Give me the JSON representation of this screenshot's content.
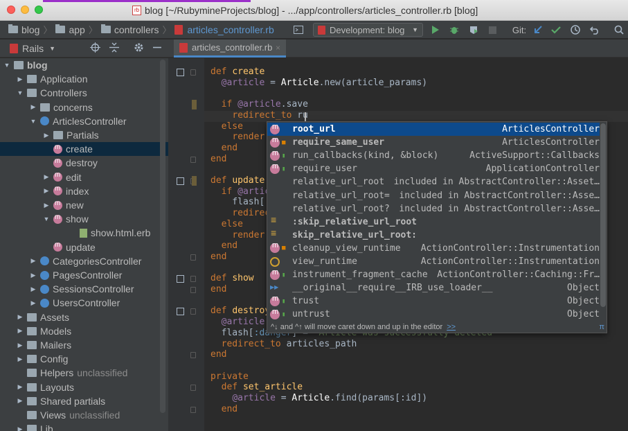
{
  "window": {
    "title": "blog [~/RubymineProjects/blog] - .../app/controllers/articles_controller.rb [blog]",
    "file_badge": "rb"
  },
  "breadcrumb": [
    "blog",
    "app",
    "controllers",
    "articles_controller.rb"
  ],
  "toolbar": {
    "run_config": "Development: blog",
    "git_label": "Git:"
  },
  "project_panel": {
    "title": "Rails"
  },
  "editor_tab": {
    "label": "articles_controller.rb",
    "close": "×"
  },
  "tree": [
    {
      "label": "blog",
      "indent": 0,
      "toggle": "▼",
      "icon": "folder",
      "bold": true
    },
    {
      "label": "Application",
      "indent": 1,
      "toggle": "▶",
      "icon": "folder"
    },
    {
      "label": "Controllers",
      "indent": 1,
      "toggle": "▼",
      "icon": "folder"
    },
    {
      "label": "concerns",
      "indent": 2,
      "toggle": "▶",
      "icon": "folder"
    },
    {
      "label": "ArticlesController",
      "indent": 2,
      "toggle": "▼",
      "icon": "ctrl"
    },
    {
      "label": "Partials",
      "indent": 3,
      "toggle": "▶",
      "icon": "folder"
    },
    {
      "label": "create",
      "indent": 3,
      "toggle": "",
      "icon": "m",
      "selected": true
    },
    {
      "label": "destroy",
      "indent": 3,
      "toggle": "",
      "icon": "m"
    },
    {
      "label": "edit",
      "indent": 3,
      "toggle": "▶",
      "icon": "m"
    },
    {
      "label": "index",
      "indent": 3,
      "toggle": "▶",
      "icon": "m"
    },
    {
      "label": "new",
      "indent": 3,
      "toggle": "▶",
      "icon": "m"
    },
    {
      "label": "show",
      "indent": 3,
      "toggle": "▼",
      "icon": "m"
    },
    {
      "label": "show.html.erb",
      "indent": 5,
      "toggle": "",
      "icon": "erb"
    },
    {
      "label": "update",
      "indent": 3,
      "toggle": "",
      "icon": "m"
    },
    {
      "label": "CategoriesController",
      "indent": 2,
      "toggle": "▶",
      "icon": "ctrl"
    },
    {
      "label": "PagesController",
      "indent": 2,
      "toggle": "▶",
      "icon": "ctrl"
    },
    {
      "label": "SessionsController",
      "indent": 2,
      "toggle": "▶",
      "icon": "ctrl"
    },
    {
      "label": "UsersController",
      "indent": 2,
      "toggle": "▶",
      "icon": "ctrl"
    },
    {
      "label": "Assets",
      "indent": 1,
      "toggle": "▶",
      "icon": "folder"
    },
    {
      "label": "Models",
      "indent": 1,
      "toggle": "▶",
      "icon": "folder"
    },
    {
      "label": "Mailers",
      "indent": 1,
      "toggle": "▶",
      "icon": "folder"
    },
    {
      "label": "Config",
      "indent": 1,
      "toggle": "▶",
      "icon": "folder"
    },
    {
      "label": "Helpers",
      "indent": 1,
      "toggle": "",
      "icon": "folder",
      "suffix": "unclassified"
    },
    {
      "label": "Layouts",
      "indent": 1,
      "toggle": "▶",
      "icon": "folder"
    },
    {
      "label": "Shared partials",
      "indent": 1,
      "toggle": "▶",
      "icon": "folder"
    },
    {
      "label": "Views",
      "indent": 1,
      "toggle": "",
      "icon": "folder",
      "suffix": "unclassified"
    },
    {
      "label": "Lib",
      "indent": 1,
      "toggle": "▶",
      "icon": "folder"
    }
  ],
  "code_lines": [
    [
      [
        "kw",
        "def "
      ],
      [
        "fn",
        "create"
      ]
    ],
    [
      [
        "",
        "  "
      ],
      [
        "iv",
        "@article"
      ],
      [
        "",
        " = "
      ],
      [
        "cls",
        "Article"
      ],
      [
        "",
        ".new(article_params)"
      ]
    ],
    [
      [
        "",
        ""
      ]
    ],
    [
      [
        "",
        "  "
      ],
      [
        "kw",
        "if "
      ],
      [
        "iv",
        "@article"
      ],
      [
        "",
        ".save"
      ]
    ],
    [
      [
        "",
        "    "
      ],
      [
        "kw",
        "redirect_to "
      ],
      [
        "",
        "ru"
      ]
    ],
    [
      [
        "",
        "  "
      ],
      [
        "kw",
        "else"
      ]
    ],
    [
      [
        "",
        "    "
      ],
      [
        "kw",
        "render"
      ]
    ],
    [
      [
        "",
        "  "
      ],
      [
        "kw",
        "end"
      ]
    ],
    [
      [
        "kw",
        "end"
      ]
    ],
    [
      [
        "",
        ""
      ]
    ],
    [
      [
        "kw",
        "def "
      ],
      [
        "fn",
        "update"
      ]
    ],
    [
      [
        "",
        "  "
      ],
      [
        "kw",
        "if "
      ],
      [
        "iv",
        "@artic"
      ]
    ],
    [
      [
        "",
        "    flash[:"
      ]
    ],
    [
      [
        "",
        "    "
      ],
      [
        "kw",
        "redirec"
      ]
    ],
    [
      [
        "",
        "  "
      ],
      [
        "kw",
        "else"
      ]
    ],
    [
      [
        "",
        "    "
      ],
      [
        "kw",
        "render"
      ]
    ],
    [
      [
        "",
        "  "
      ],
      [
        "kw",
        "end"
      ]
    ],
    [
      [
        "kw",
        "end"
      ]
    ],
    [
      [
        "",
        ""
      ]
    ],
    [
      [
        "kw",
        "def "
      ],
      [
        "fn",
        "show"
      ]
    ],
    [
      [
        "kw",
        "end"
      ]
    ],
    [
      [
        "",
        ""
      ]
    ],
    [
      [
        "kw",
        "def "
      ],
      [
        "fn",
        "destroy"
      ]
    ],
    [
      [
        "",
        "  "
      ],
      [
        "iv",
        "@article"
      ],
      [
        "",
        "."
      ]
    ],
    [
      [
        "",
        "  flash["
      ],
      [
        "sym",
        ":danger"
      ],
      [
        "",
        "] = "
      ],
      [
        "str",
        "\"Article was successfully deleted\""
      ]
    ],
    [
      [
        "",
        "  "
      ],
      [
        "kw",
        "redirect_to "
      ],
      [
        "",
        "articles_path"
      ]
    ],
    [
      [
        "kw",
        "end"
      ]
    ],
    [
      [
        "",
        ""
      ]
    ],
    [
      [
        "kw",
        "private"
      ]
    ],
    [
      [
        "",
        "  "
      ],
      [
        "kw",
        "def "
      ],
      [
        "fn",
        "set_article"
      ]
    ],
    [
      [
        "",
        "    "
      ],
      [
        "iv",
        "@article"
      ],
      [
        "",
        " = "
      ],
      [
        "cls",
        "Article"
      ],
      [
        "",
        ".find(params[:id])"
      ]
    ],
    [
      [
        "",
        "  "
      ],
      [
        "kw",
        "end"
      ]
    ]
  ],
  "completion": {
    "items": [
      {
        "name": "root_url",
        "bold": true,
        "type": "ArticlesController",
        "icon": "m",
        "vis": "",
        "selected": true
      },
      {
        "name": "require_same_user",
        "bold": true,
        "type": "ArticlesController",
        "icon": "m",
        "vis": "lock"
      },
      {
        "name": "run_callbacks(kind, &block)",
        "type": "ActiveSupport::Callbacks",
        "icon": "m",
        "vis": "pub"
      },
      {
        "name": "require_user",
        "type": "ApplicationController",
        "icon": "m",
        "vis": "pub"
      },
      {
        "name": "relative_url_root",
        "type": "included in AbstractController::Asset…",
        "icon": "blank",
        "vis": ""
      },
      {
        "name": "relative_url_root=",
        "type": "included in AbstractController::Asse…",
        "icon": "blank",
        "vis": ""
      },
      {
        "name": "relative_url_root?",
        "type": "included in AbstractController::Asse…",
        "icon": "blank",
        "vis": ""
      },
      {
        "name": ":skip_relative_url_root",
        "bold": true,
        "type": "",
        "icon": "field",
        "vis": ""
      },
      {
        "name": "skip_relative_url_root:",
        "bold": true,
        "type": "",
        "icon": "field",
        "vis": ""
      },
      {
        "name": "cleanup_view_runtime",
        "type": "ActionController::Instrumentation",
        "icon": "m",
        "vis": "lock"
      },
      {
        "name": "view_runtime",
        "type": "ActionController::Instrumentation",
        "icon": "ring",
        "vis": ""
      },
      {
        "name": "instrument_fragment_cache",
        "type": "ActionController::Caching::Fr…",
        "icon": "m",
        "vis": "pub"
      },
      {
        "name": "__original__require__IRB_use_loader__",
        "type": "Object",
        "icon": "ff",
        "vis": ""
      },
      {
        "name": "trust",
        "type": "Object",
        "icon": "m",
        "vis": "pub"
      },
      {
        "name": "untrust",
        "type": "Object",
        "icon": "m",
        "vis": "pub"
      }
    ],
    "footer": "^↓ and ^↑ will move caret down and up in the editor",
    "footer_link": ">>",
    "footer_pi": "π"
  },
  "colors": {
    "accent": "#4a88c7",
    "selection": "#0d4a8c",
    "editor_bg": "#2b2b2b",
    "keyword": "#cc7832"
  }
}
